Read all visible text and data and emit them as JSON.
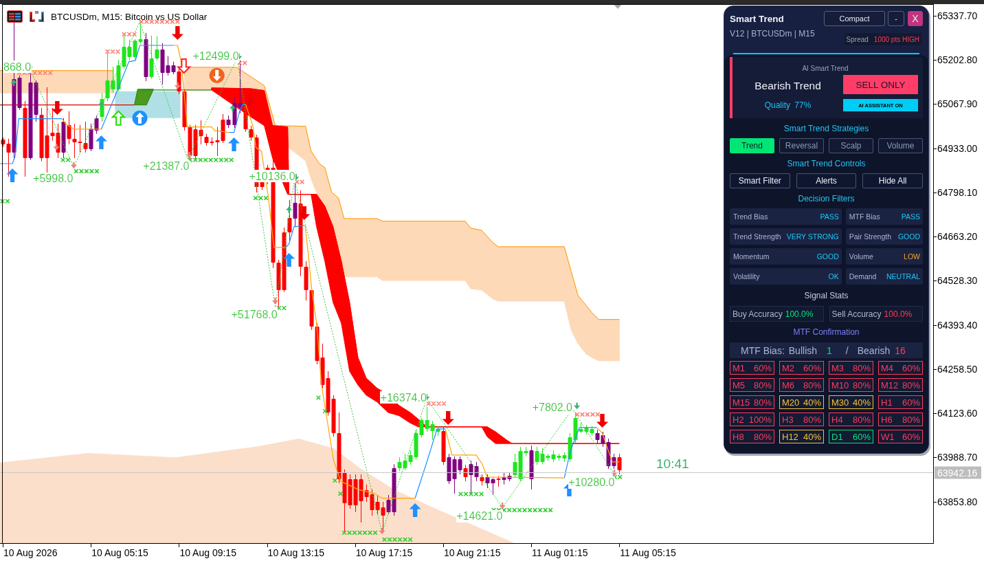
{
  "chart": {
    "title": "BTCUSDm, M15: Bitcoin vs US Dollar",
    "price_labels": [
      "65337.70",
      "65202.80",
      "65067.90",
      "64933.00",
      "64798.10",
      "64663.20",
      "64528.30",
      "64393.40",
      "64258.50",
      "64123.60",
      "63988.70",
      "63853.80"
    ],
    "time_labels": [
      "10 Aug 2026",
      "10 Aug 05:15",
      "10 Aug 09:15",
      "10 Aug 13:15",
      "10 Aug 17:15",
      "10 Aug 21:15",
      "11 Aug 01:15",
      "11 Aug 05:15"
    ],
    "trade_labels": [
      "868.0",
      "+5998.0",
      "+21387.0",
      "+12499.0",
      "+10136.0",
      "+51768.0",
      "+16374.0",
      "+14621.0",
      "+7802.0",
      "+10280.0"
    ],
    "current_price": "63942.16",
    "countdown": "10:41"
  },
  "panel": {
    "title": "Smart Trend",
    "buttons": [
      {
        "label": "Compact",
        "kind": "text"
      },
      {
        "label": "-",
        "kind": "minimize"
      },
      {
        "label": "X",
        "kind": "close"
      }
    ],
    "subtitle": "V12 | BTCUSDm | M15",
    "spread": {
      "label": "Spread",
      "value": "1000 pts HIGH"
    },
    "signal": {
      "heading": "AI Smart Trend",
      "trend": "Bearish Trend",
      "bearish": true,
      "quality": "Quality 77%",
      "action": "SELL ONLY",
      "assistant": "AI ASSISTANT ON"
    },
    "strategies": {
      "heading": "Smart Trend Strategies",
      "tabs": [
        {
          "label": "Trend",
          "selected": true
        },
        {
          "label": "Reversal",
          "selected": false
        },
        {
          "label": "Scalp",
          "selected": false
        },
        {
          "label": "Volume",
          "selected": false
        }
      ]
    },
    "controls": {
      "heading": "Smart Trend Controls",
      "buttons": [
        "Smart Filter",
        "Alerts",
        "Hide All"
      ]
    },
    "filters": {
      "heading": "Decision Filters",
      "items": [
        {
          "label": "Trend Bias",
          "value": "PASS",
          "color": "#1ec8f5"
        },
        {
          "label": "MTF Bias",
          "value": "PASS",
          "color": "#1ec8f5"
        },
        {
          "label": "Trend Strength",
          "value": "VERY STRONG",
          "color": "#1ec8f5"
        },
        {
          "label": "Pair Strength",
          "value": "GOOD",
          "color": "#1ec8f5"
        },
        {
          "label": "Momentum",
          "value": "GOOD",
          "color": "#1ec8f5"
        },
        {
          "label": "Volume",
          "value": "LOW",
          "color": "#f5a623"
        },
        {
          "label": "Volatility",
          "value": "OK",
          "color": "#1ec8f5"
        },
        {
          "label": "Demand",
          "value": "NEUTRAL",
          "color": "#1ec8f5"
        }
      ]
    },
    "signal_stats": {
      "heading": "Signal Stats",
      "items": [
        {
          "label": "Buy Accuracy",
          "value": "100.0%",
          "color": "#00e676"
        },
        {
          "label": "Sell Accuracy",
          "value": "100.0%",
          "color": "#ff3b5c"
        }
      ]
    },
    "mtf": {
      "heading": "MTF Confirmation",
      "bias_label": "MTF Bias:",
      "bullish_label": "Bullish",
      "bullish_count": "1",
      "separator": "/",
      "bearish_label": "Bearish",
      "bearish_count": "16",
      "timeframes": [
        {
          "label": "M1",
          "value": "60%",
          "color": "#ff3b5c"
        },
        {
          "label": "M2",
          "value": "60%",
          "color": "#ff3b5c"
        },
        {
          "label": "M3",
          "value": "80%",
          "color": "#ff3b5c"
        },
        {
          "label": "M4",
          "value": "60%",
          "color": "#ff3b5c"
        },
        {
          "label": "M5",
          "value": "80%",
          "color": "#ff3b5c"
        },
        {
          "label": "M6",
          "value": "80%",
          "color": "#ff3b5c"
        },
        {
          "label": "M10",
          "value": "80%",
          "color": "#ff3b5c"
        },
        {
          "label": "M12",
          "value": "80%",
          "color": "#ff3b5c"
        },
        {
          "label": "M15",
          "value": "80%",
          "color": "#ff3b5c"
        },
        {
          "label": "M20",
          "value": "40%",
          "color": "#f5c132"
        },
        {
          "label": "M30",
          "value": "40%",
          "color": "#f5c132"
        },
        {
          "label": "H1",
          "value": "60%",
          "color": "#ff3b5c"
        },
        {
          "label": "H2",
          "value": "100%",
          "color": "#ff3b5c"
        },
        {
          "label": "H3",
          "value": "80%",
          "color": "#ff3b5c"
        },
        {
          "label": "H4",
          "value": "80%",
          "color": "#ff3b5c"
        },
        {
          "label": "H6",
          "value": "80%",
          "color": "#ff3b5c"
        },
        {
          "label": "H8",
          "value": "80%",
          "color": "#ff3b5c"
        },
        {
          "label": "H12",
          "value": "40%",
          "color": "#f5c132"
        },
        {
          "label": "D1",
          "value": "60%",
          "color": "#00e676"
        },
        {
          "label": "W1",
          "value": "60%",
          "color": "#ff3b5c"
        }
      ]
    }
  }
}
